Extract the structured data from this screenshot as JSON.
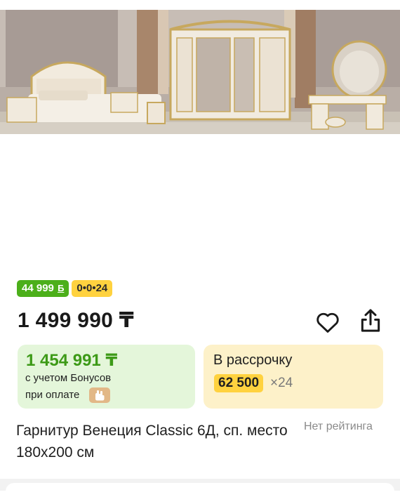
{
  "product": {
    "bonus_badge": {
      "amount": "44 999",
      "currency": "Б"
    },
    "installment_badge": "0•0•24",
    "price": "1 499 990 ₸",
    "bonus_price": "1 454 991 ₸",
    "bonus_note_line1": "с учетом Бонусов",
    "bonus_note_line2": "при оплате",
    "installment": {
      "label": "В рассрочку",
      "monthly": "62 500",
      "months": "×24"
    },
    "title": "Гарнитур Венеция Classic 6Д, сп. место 180х200 см",
    "rating_status": "Нет рейтинга"
  },
  "icons": {
    "favorite": "heart-icon",
    "share": "share-icon",
    "hand": "hand-payment-icon"
  },
  "colors": {
    "bonus_green": "#4caf1a",
    "installment_yellow": "#ffd23f",
    "green_panel": "#e4f6da",
    "yellow_panel": "#fdf1c9"
  }
}
